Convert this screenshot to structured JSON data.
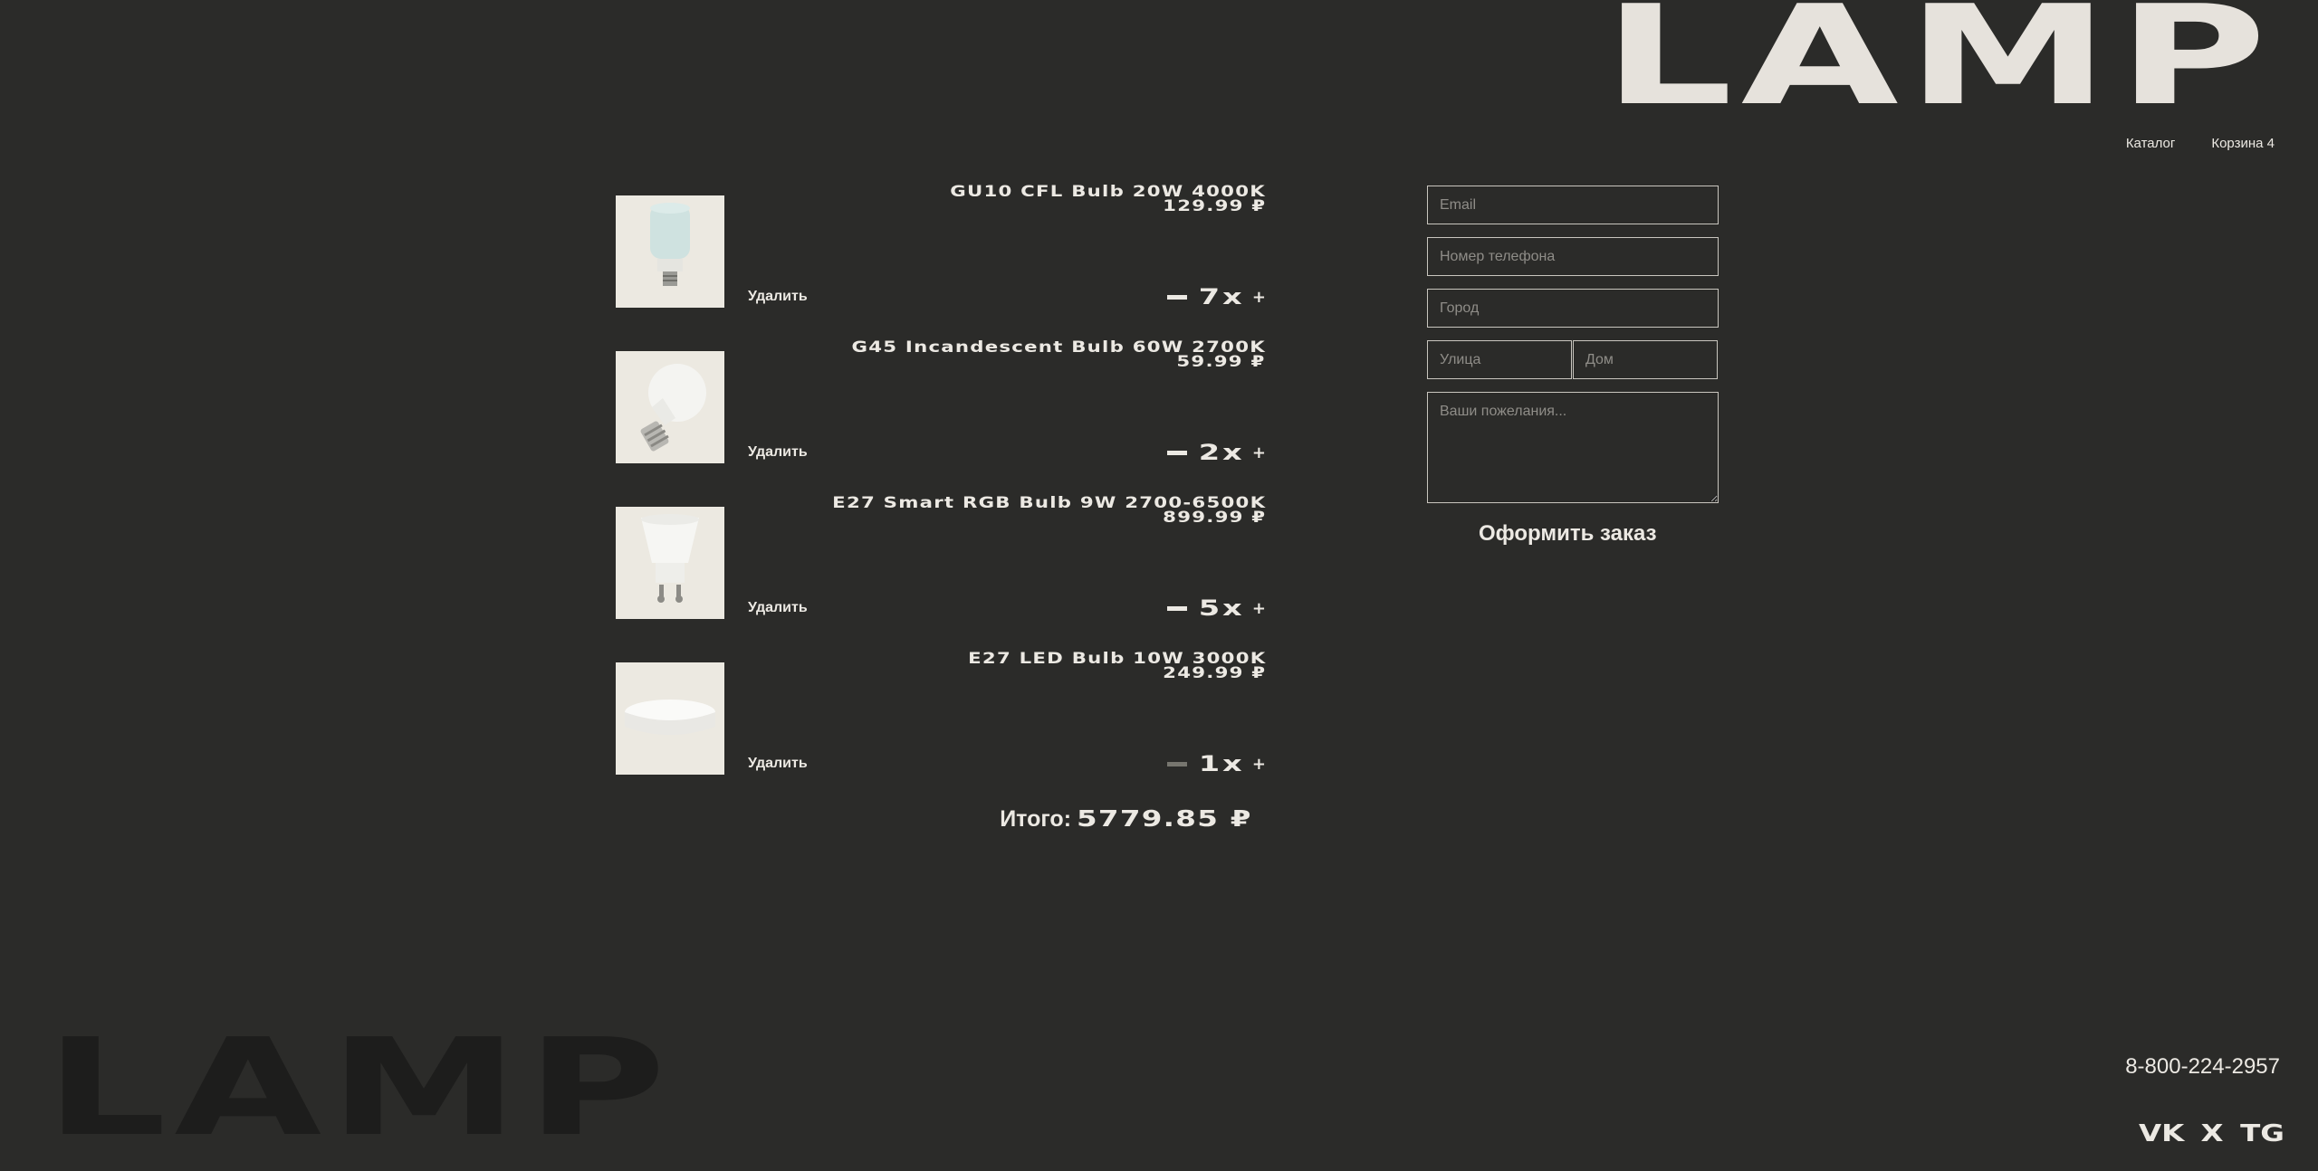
{
  "header": {
    "logo": "LAMP",
    "nav": {
      "catalog": "Каталог",
      "cart": "Корзина 4"
    }
  },
  "cart": {
    "items": [
      {
        "name": "GU10 CFL Bulb 20W 4000K",
        "price": "129.99 ₽",
        "remove": "Удалить",
        "quantity": "7x"
      },
      {
        "name": "G45 Incandescent Bulb 60W 2700K",
        "price": "59.99 ₽",
        "remove": "Удалить",
        "quantity": "2x"
      },
      {
        "name": "E27 Smart RGB Bulb 9W 2700-6500K",
        "price": "899.99 ₽",
        "remove": "Удалить",
        "quantity": "5x"
      },
      {
        "name": "E27 LED Bulb 10W 3000K",
        "price": "249.99 ₽",
        "remove": "Удалить",
        "quantity": "1x"
      }
    ],
    "total_label": "Итого:",
    "total_value": "5779.85 ₽"
  },
  "form": {
    "email_placeholder": "Email",
    "phone_placeholder": "Номер телефона",
    "city_placeholder": "Город",
    "street_placeholder": "Улица",
    "house_placeholder": "Дом",
    "comment_placeholder": "Ваши пожелания...",
    "submit_label": "Оформить заказ"
  },
  "footer": {
    "logo": "LAMP",
    "phone": "8-800-224-2957",
    "socials": [
      "VK",
      "X",
      "TG"
    ]
  }
}
